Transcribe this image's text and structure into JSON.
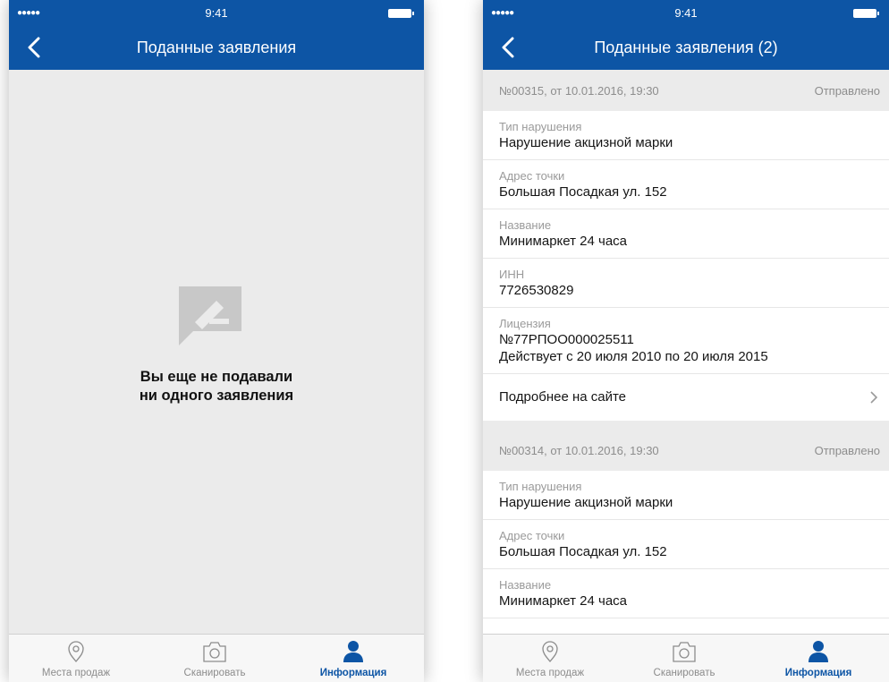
{
  "status_bar": {
    "time": "9:41",
    "signal": "●●●●●"
  },
  "screen_empty": {
    "title": "Поданные заявления",
    "empty_line1": "Вы еще не подавали",
    "empty_line2": "ни одного заявления"
  },
  "screen_list": {
    "title": "Поданные заявления (2)",
    "applications": [
      {
        "number": "№00315, от 10.01.2016, 19:30",
        "status": "Отправлено",
        "violation_label": "Тип нарушения",
        "violation": "Нарушение акцизной марки",
        "address_label": "Адрес точки",
        "address": "Большая Посадкая ул. 152",
        "name_label": "Название",
        "name": "Минимаркет 24 часа",
        "inn_label": "ИНН",
        "inn": "7726530829",
        "license_label": "Лицензия",
        "license_number": "№77РПОО000025511",
        "license_valid": "Действует с 20 июля 2010 по 20 июля 2015",
        "more_link": "Подробнее на сайте"
      },
      {
        "number": "№00314, от 10.01.2016, 19:30",
        "status": "Отправлено",
        "violation_label": "Тип нарушения",
        "violation": "Нарушение акцизной марки",
        "address_label": "Адрес точки",
        "address": "Большая Посадкая ул. 152",
        "name_label": "Название",
        "name": "Минимаркет 24 часа"
      }
    ]
  },
  "tabbar": {
    "tabs": [
      {
        "label": "Места продаж",
        "icon": "map-pin-icon",
        "active": false
      },
      {
        "label": "Сканировать",
        "icon": "camera-icon",
        "active": false
      },
      {
        "label": "Информация",
        "icon": "person-icon",
        "active": true
      }
    ]
  },
  "colors": {
    "brand": "#0d55a5",
    "background": "#ebebeb",
    "muted_text": "#9a9a9a"
  }
}
